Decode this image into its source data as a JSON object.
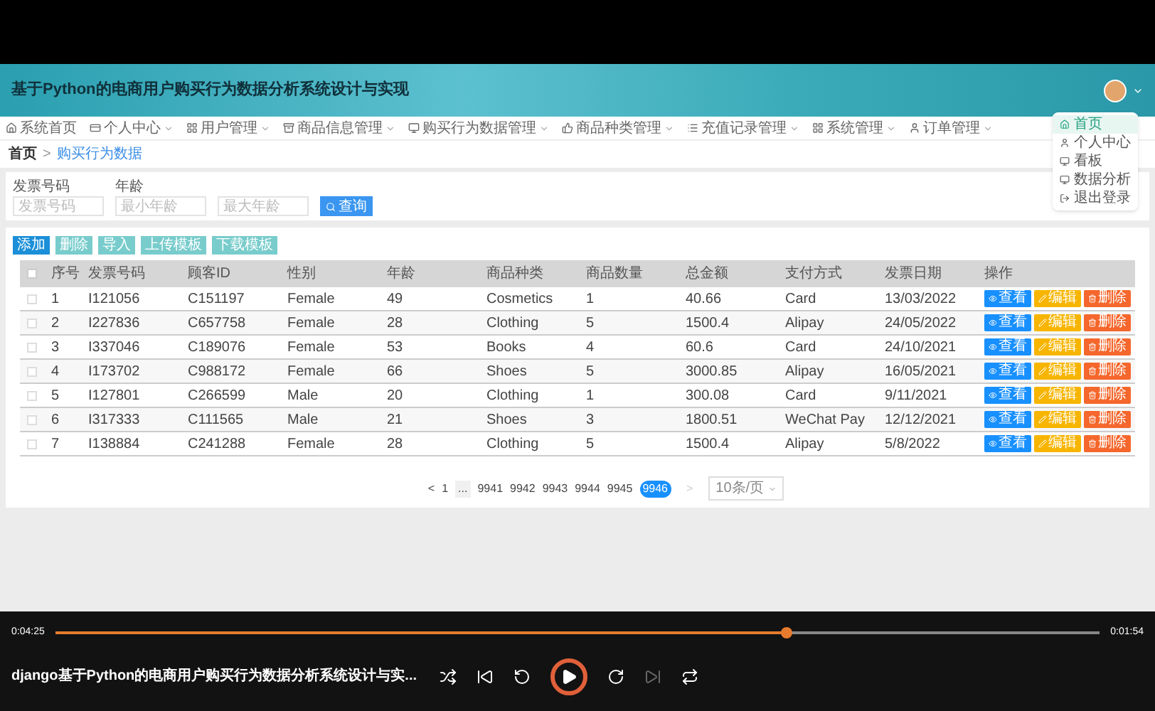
{
  "header": {
    "title": "基于Python的电商用户购买行为数据分析系统设计与实现"
  },
  "user_menu": {
    "items": [
      {
        "label": "首页",
        "selected": true
      },
      {
        "label": "个人中心",
        "selected": false
      },
      {
        "label": "看板",
        "selected": false
      },
      {
        "label": "数据分析",
        "selected": false
      },
      {
        "label": "退出登录",
        "selected": false
      }
    ]
  },
  "nav": {
    "items": [
      {
        "label": "系统首页",
        "dropdown": false
      },
      {
        "label": "个人中心",
        "dropdown": true
      },
      {
        "label": "用户管理",
        "dropdown": true
      },
      {
        "label": "商品信息管理",
        "dropdown": true
      },
      {
        "label": "购买行为数据管理",
        "dropdown": true
      },
      {
        "label": "商品种类管理",
        "dropdown": true
      },
      {
        "label": "充值记录管理",
        "dropdown": true
      },
      {
        "label": "系统管理",
        "dropdown": true
      },
      {
        "label": "订单管理",
        "dropdown": true
      }
    ]
  },
  "breadcrumb": {
    "home": "首页",
    "separator": ">",
    "current": "购买行为数据"
  },
  "search": {
    "fields": [
      {
        "label": "发票号码",
        "placeholder": "发票号码"
      },
      {
        "label": "年龄",
        "placeholder": "最小年龄"
      },
      {
        "placeholder": "最大年龄"
      }
    ],
    "button": "查询"
  },
  "actions": [
    {
      "label": "添加",
      "kind": "primary"
    },
    {
      "label": "删除",
      "kind": "secondary"
    },
    {
      "label": "导入",
      "kind": "secondary"
    },
    {
      "label": "上传模板",
      "kind": "secondary"
    },
    {
      "label": "下载模板",
      "kind": "secondary"
    }
  ],
  "table": {
    "all_checked": false,
    "columns": [
      "序号",
      "发票号码",
      "顾客ID",
      "性别",
      "年龄",
      "商品种类",
      "商品数量",
      "总金额",
      "支付方式",
      "发票日期",
      "操作"
    ],
    "rows": [
      {
        "checked": false,
        "cells": [
          "1",
          "I121056",
          "C151197",
          "Female",
          "49",
          "Cosmetics",
          "1",
          "40.66",
          "Card",
          "13/03/2022"
        ],
        "buttons": [
          {
            "label": "查看",
            "kind": "view"
          },
          {
            "label": "编辑",
            "kind": "edit"
          },
          {
            "label": "删除",
            "kind": "delete"
          }
        ]
      },
      {
        "checked": false,
        "cells": [
          "2",
          "I227836",
          "C657758",
          "Female",
          "28",
          "Clothing",
          "5",
          "1500.4",
          "Alipay",
          "24/05/2022"
        ],
        "buttons": [
          {
            "label": "查看",
            "kind": "view"
          },
          {
            "label": "编辑",
            "kind": "edit"
          },
          {
            "label": "删除",
            "kind": "delete"
          }
        ]
      },
      {
        "checked": false,
        "cells": [
          "3",
          "I337046",
          "C189076",
          "Female",
          "53",
          "Books",
          "4",
          "60.6",
          "Card",
          "24/10/2021"
        ],
        "buttons": [
          {
            "label": "查看",
            "kind": "view"
          },
          {
            "label": "编辑",
            "kind": "edit"
          },
          {
            "label": "删除",
            "kind": "delete"
          }
        ]
      },
      {
        "checked": false,
        "cells": [
          "4",
          "I173702",
          "C988172",
          "Female",
          "66",
          "Shoes",
          "5",
          "3000.85",
          "Alipay",
          "16/05/2021"
        ],
        "buttons": [
          {
            "label": "查看",
            "kind": "view"
          },
          {
            "label": "编辑",
            "kind": "edit"
          },
          {
            "label": "删除",
            "kind": "delete"
          }
        ]
      },
      {
        "checked": false,
        "cells": [
          "5",
          "I127801",
          "C266599",
          "Male",
          "20",
          "Clothing",
          "1",
          "300.08",
          "Card",
          "9/11/2021"
        ],
        "buttons": [
          {
            "label": "查看",
            "kind": "view"
          },
          {
            "label": "编辑",
            "kind": "edit"
          },
          {
            "label": "删除",
            "kind": "delete"
          }
        ]
      },
      {
        "checked": false,
        "cells": [
          "6",
          "I317333",
          "C111565",
          "Male",
          "21",
          "Shoes",
          "3",
          "1800.51",
          "WeChat Pay",
          "12/12/2021"
        ],
        "buttons": [
          {
            "label": "查看",
            "kind": "view"
          },
          {
            "label": "编辑",
            "kind": "edit"
          },
          {
            "label": "删除",
            "kind": "delete"
          }
        ]
      },
      {
        "checked": false,
        "cells": [
          "7",
          "I138884",
          "C241288",
          "Female",
          "28",
          "Clothing",
          "5",
          "1500.4",
          "Alipay",
          "5/8/2022"
        ],
        "buttons": [
          {
            "label": "查看",
            "kind": "view"
          },
          {
            "label": "编辑",
            "kind": "edit"
          },
          {
            "label": "删除",
            "kind": "delete"
          }
        ]
      }
    ]
  },
  "pagination": {
    "prev": "<",
    "next": ">",
    "pages": [
      {
        "label": "1",
        "selected": false
      },
      {
        "label": "...",
        "selected": false
      },
      {
        "label": "9941",
        "selected": false
      },
      {
        "label": "9942",
        "selected": false
      },
      {
        "label": "9943",
        "selected": false
      },
      {
        "label": "9944",
        "selected": false
      },
      {
        "label": "9945",
        "selected": false
      },
      {
        "label": "9946",
        "selected": true
      }
    ],
    "page_size": "10条/页"
  },
  "player": {
    "elapsed": "0:04:25",
    "remaining": "0:01:54",
    "progress": {
      "level": 0.7
    },
    "title": "django基于Python的电商用户购买行为数据分析系统设计与实..."
  }
}
